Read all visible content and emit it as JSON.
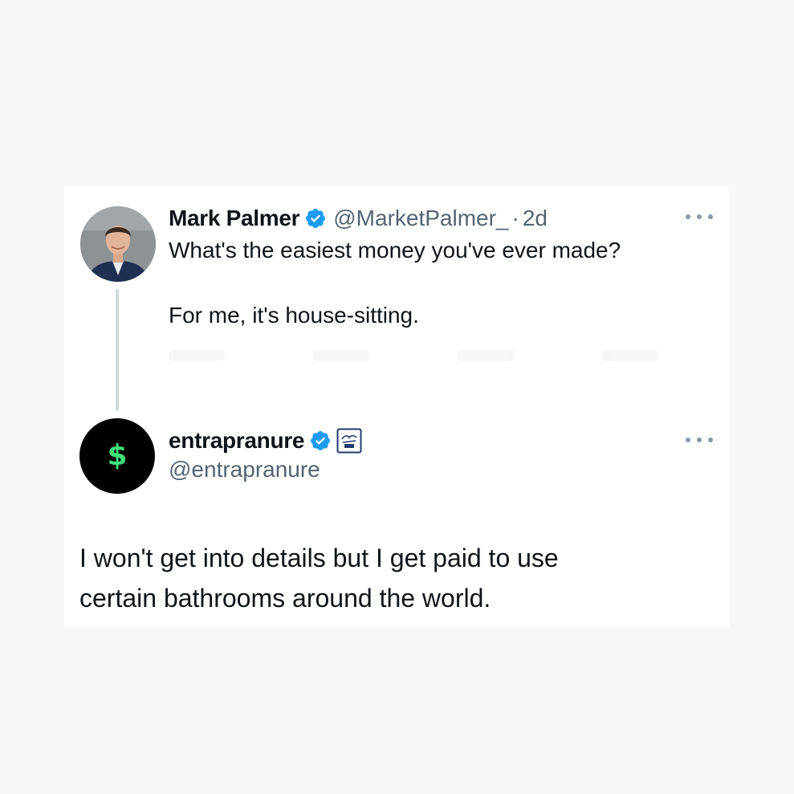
{
  "tweet": {
    "author_name": "Mark Palmer",
    "author_handle": "@MarketPalmer_",
    "separator": "·",
    "time": "2d",
    "text_line1": "What's the easiest money you've ever made?",
    "text_line2": "For me, it's house-sitting.",
    "avatar_icon": "person-photo-avatar",
    "verified_icon": "verified-badge-icon"
  },
  "reply": {
    "author_name": "entrapranure",
    "author_handle": "@entrapranure",
    "avatar_symbol": "$",
    "text_line1": "I won't get into details but I get paid to use",
    "text_line2": "certain bathrooms around the world.",
    "verified_icon": "verified-badge-icon",
    "affiliate_icon": "affiliate-badge-icon"
  },
  "colors": {
    "background": "#f8f8f8",
    "card": "#ffffff",
    "text": "#0f1419",
    "secondary_text": "#536471",
    "verified_blue": "#1d9bf0",
    "thread_line": "#cfd9de",
    "dollar_green": "#3ee07a"
  }
}
